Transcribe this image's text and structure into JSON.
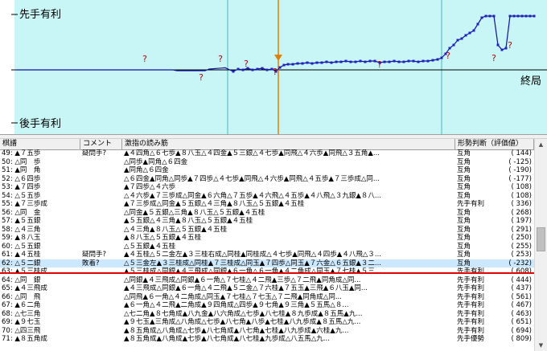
{
  "chart": {
    "label_top": "先手有利",
    "label_bottom": "後手有利",
    "label_end": "終局",
    "question_mark": "?",
    "colors": {
      "background": "#c8f5f5",
      "line": "#1010a0",
      "marker": "#2020c0",
      "cursor": "#e08000",
      "grid": "#40c0c0",
      "question": "#c00000"
    }
  },
  "table": {
    "headers": [
      "棋譜",
      "コメント",
      "激指の読み筋",
      "形勢判断（評価値）"
    ],
    "rows": [
      {
        "move": "49: ▲７五歩",
        "comment": "疑問手?",
        "pv": "▲４四角△６七歩▲８八玉△４四金▲５三銀△４七歩▲同飛△４六歩▲同飛△３五角▲...",
        "judge": "互角",
        "eval": "(    144)"
      },
      {
        "move": "50: △同　歩",
        "comment": "",
        "pv": "△同歩▲同角△６四金",
        "judge": "互角",
        "eval": "(   -125)"
      },
      {
        "move": "51: ▲同　角",
        "comment": "",
        "pv": "▲同角△６四金",
        "judge": "互角",
        "eval": "(   -190)"
      },
      {
        "move": "52: △６四歩",
        "comment": "",
        "pv": "△６四金▲同角△同歩▲７四歩△４七歩▲同飛△４六歩▲同飛△４五歩▲７三歩成△同...",
        "judge": "互角",
        "eval": "(   -177)"
      },
      {
        "move": "53: ▲７四歩",
        "comment": "",
        "pv": "▲７四歩△４六歩",
        "judge": "互角",
        "eval": "(    108)"
      },
      {
        "move": "54: △５五歩",
        "comment": "",
        "pv": "△４六歩▲７三歩成△同金▲６六角△７五歩▲４六飛△４五歩▲４八飛△３九銀▲８八...",
        "judge": "互角",
        "eval": "(    108)"
      },
      {
        "move": "55: ▲７三歩成",
        "comment": "",
        "pv": "▲７三歩成△同金▲５五銀△４三角▲８八玉△５五銀▲４五桂",
        "judge": "先手有利",
        "eval": "(    336)"
      },
      {
        "move": "56: △同　金",
        "comment": "",
        "pv": "△同金▲５五銀△三角▲８八玉△５五銀▲４五桂",
        "judge": "互角",
        "eval": "(    268)"
      },
      {
        "move": "57: ▲５五銀",
        "comment": "",
        "pv": "▲５五銀△４三角▲８八玉△５五銀▲４五桂",
        "judge": "互角",
        "eval": "(    197)"
      },
      {
        "move": "58: △４三角",
        "comment": "",
        "pv": "△４三角▲８八玉△５五銀▲４五桂",
        "judge": "互角",
        "eval": "(    291)"
      },
      {
        "move": "59: ▲８八玉",
        "comment": "",
        "pv": "▲８八玉△５五銀▲４五桂",
        "judge": "互角",
        "eval": "(    250)"
      },
      {
        "move": "60: △５五銀",
        "comment": "",
        "pv": "△５五銀▲４五桂",
        "judge": "互角",
        "eval": "(    255)"
      },
      {
        "move": "61: ▲４五桂",
        "comment": "疑問手?",
        "pv": "▲４五桂△５二金左▲３三桂右成△同桂▲同桂成△４七歩▲同飛△４四歩▲４八飛△３...",
        "judge": "互角",
        "eval": "(    253)"
      },
      {
        "move": "62: △５二銀",
        "comment": "敗着?",
        "pv": "△５三金左▲３三桂成△同桂▲７三桂成△同玉▲７四歩△同玉▲７六金△６五銀▲３二...",
        "judge": "互角",
        "eval": "(   -232)"
      },
      {
        "move": "63: ▲５三桂成",
        "comment": "",
        "pv": "▲５三桂成△同銀▲４三飛成△同銀▲６一角△６一角▲４二角成△同玉▲７七桂▲５三...",
        "judge": "先手有利",
        "eval": "(    608)"
      },
      {
        "move": "64: △同　銀",
        "comment": "",
        "pv": "△同銀▲４三飛成△同銀▲６一角△７七桂△４二飛▲三歩△７二飛▲同角成△同...",
        "judge": "先手有利",
        "eval": "(    444)"
      },
      {
        "move": "65: ▲４三飛成",
        "comment": "",
        "pv": "▲４三飛成△同銀▲６一角△４二飛▲５二金△７六桂▲７五玉▲三飛▲６八玉▲同...",
        "judge": "先手有利",
        "eval": "(    437)"
      },
      {
        "move": "66: △同　飛",
        "comment": "",
        "pv": "△同飛▲６一角△４二角成△同玉▲７七桂△７七玉△７二飛▲同角成△同...",
        "judge": "先手有利",
        "eval": "(    561)"
      },
      {
        "move": "67: ▲６二角",
        "comment": "",
        "pv": "▲６一角△４二飛▲二角成▲９四角成△四歩▲９七角▲９三角▲５五馬△８...",
        "judge": "先手有利",
        "eval": "(    467)"
      },
      {
        "move": "68: △七三角",
        "comment": "",
        "pv": "△七二角▲８七角成▲八九金▲八六角成△七歩▲八七桂▲８九歩成▲８五馬▲九...",
        "judge": "先手有利",
        "eval": "(    463)"
      },
      {
        "move": "69: ▲９七玉",
        "comment": "",
        "pv": "▲９七玉▲三角成△八角成△七歩▲八七角▲八歩▲七桂▲八九歩成▲８五馬△九...",
        "judge": "先手有利",
        "eval": "(    651)"
      },
      {
        "move": "70: △四三飛",
        "comment": "",
        "pv": "▲８五角成△八角成△七歩▲八七角成▲八七角▲七桂▲八九歩成▲六桂▲九...",
        "judge": "先手有利",
        "eval": "(    694)"
      },
      {
        "move": "71: ▲８五角成",
        "comment": "",
        "pv": "▲８五角成▲八角成▲七歩▲八七角成▲八七桂▲九歩成△八五馬△九...",
        "judge": "先手優勢",
        "eval": "(    809)"
      }
    ]
  }
}
